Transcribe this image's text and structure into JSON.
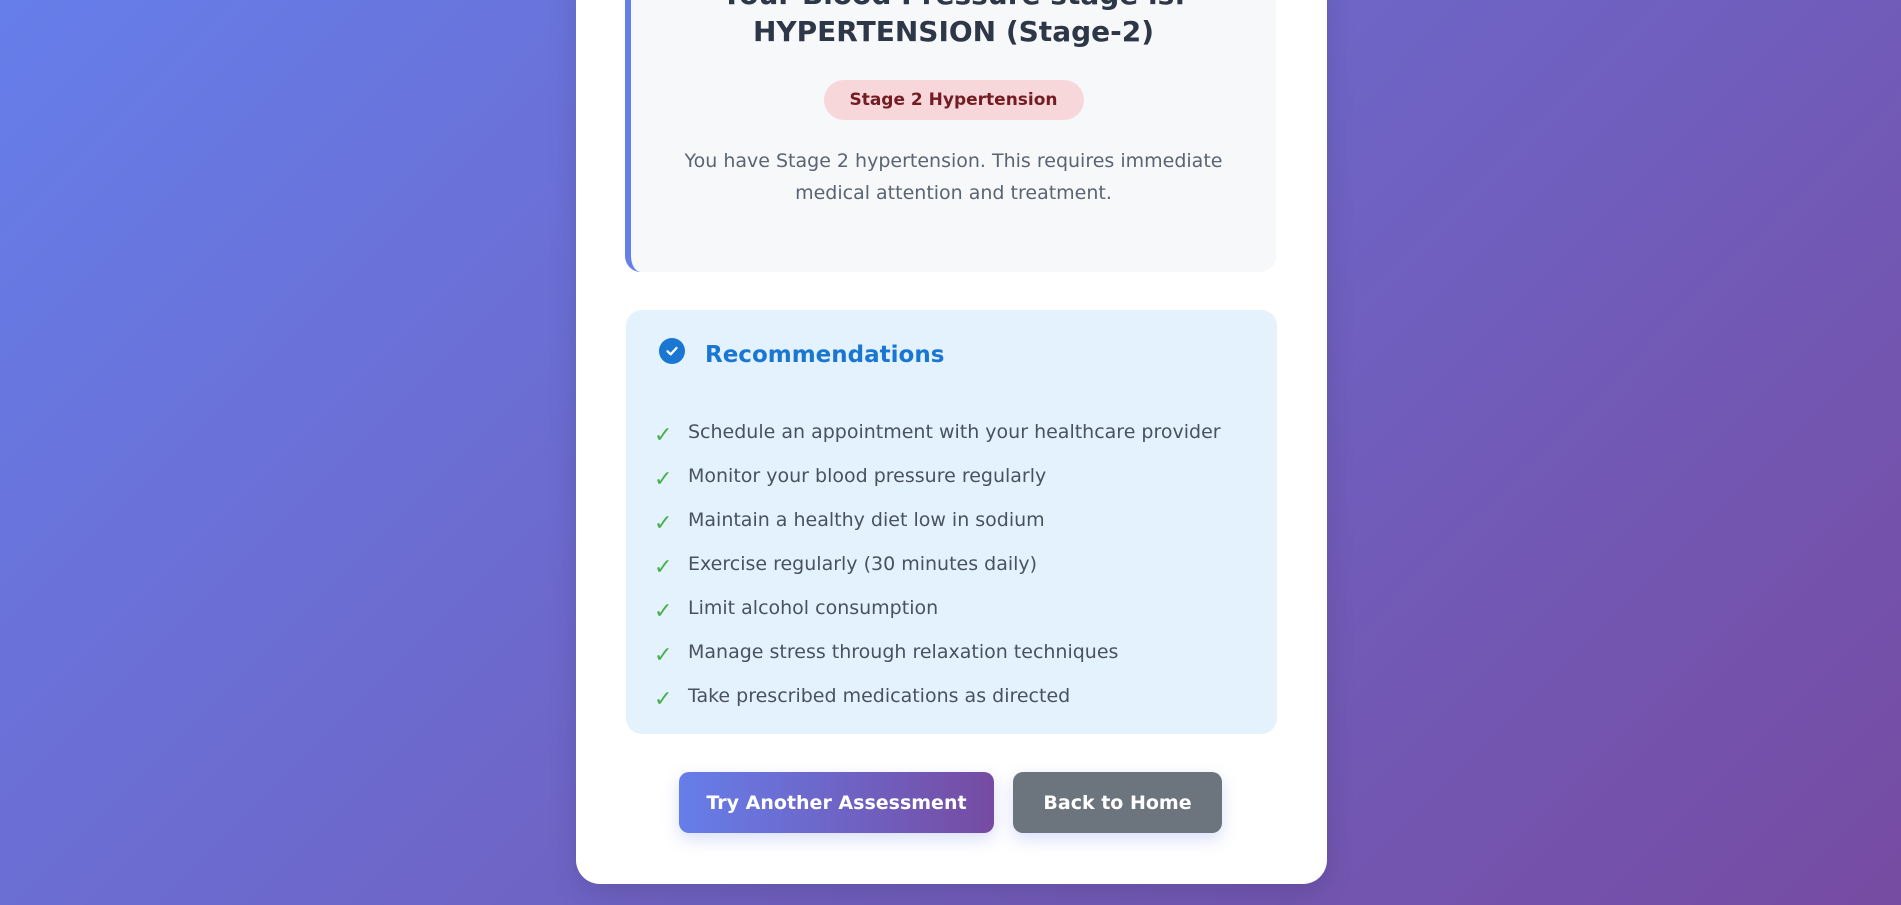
{
  "result": {
    "title_line1": "Your Blood Pressure stage is:",
    "title_line2": "HYPERTENSION (Stage-2)",
    "badge": "Stage 2 Hypertension",
    "description": "You have Stage 2 hypertension. This requires immediate medical attention and treatment.",
    "accent_color": "#667eea",
    "badge_bg_color": "#f8d7da",
    "badge_text_color": "#721c24"
  },
  "recommendations": {
    "title": "Recommendations",
    "icon": "check-circle-icon",
    "check_glyph": "✓",
    "items": [
      "Schedule an appointment with your healthcare provider",
      "Monitor your blood pressure regularly",
      "Maintain a healthy diet low in sodium",
      "Exercise regularly (30 minutes daily)",
      "Limit alcohol consumption",
      "Manage stress through relaxation techniques",
      "Take prescribed medications as directed"
    ],
    "accent_color": "#1976d2",
    "check_color": "#4caf50"
  },
  "actions": {
    "try_again_label": "Try Another Assessment",
    "home_label": "Back to Home"
  },
  "background": {
    "gradient_start": "#667eea",
    "gradient_end": "#764ba2"
  }
}
